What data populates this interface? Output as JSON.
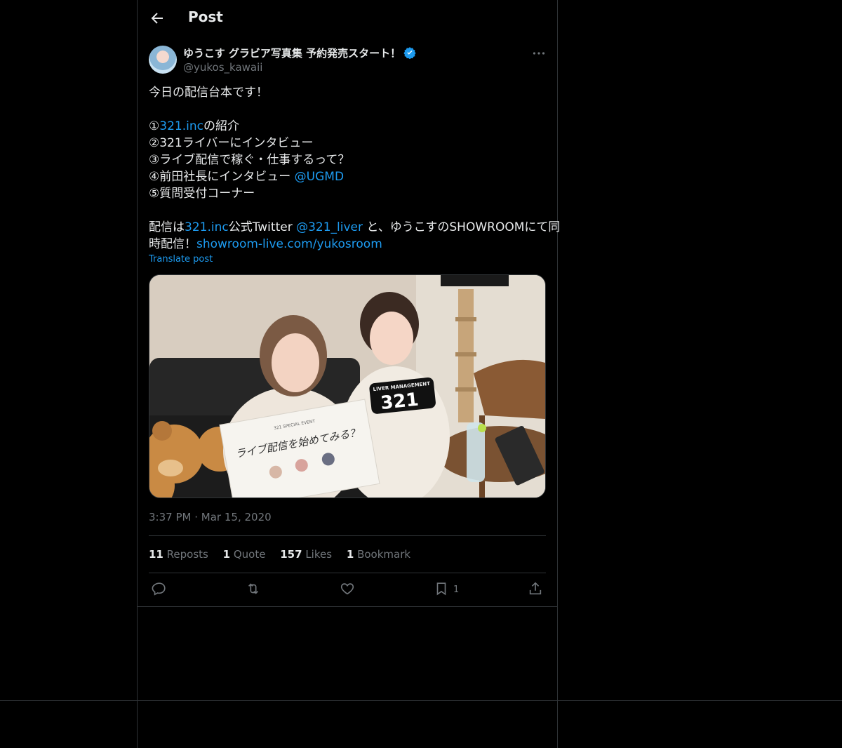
{
  "header": {
    "title": "Post"
  },
  "author": {
    "display_name": "ゆうこす グラビア写真集 予約発売スタート！",
    "handle": "@yukos_kawaii"
  },
  "tweet": {
    "line1": "今日の配信台本です！",
    "item1_num": "①",
    "item1_link": "321.inc",
    "item1_text": "の紹介",
    "item2": "②321ライバーにインタビュー",
    "item3": "③ライブ配信で稼ぐ・仕事するって？",
    "item4_text": "④前田社長にインタビュー ",
    "item4_mention": "@UGMD",
    "item5": "⑤質問受付コーナー",
    "p2_a": "配信は",
    "p2_link": "321.inc",
    "p2_b": "公式Twitter ",
    "p2_mention": "@321_liver",
    "p2_c": " と、ゆうこすのSHOWROOMにて同",
    "p2_d": "時配信！",
    "p2_url": "showroom-live.com/yukosroom",
    "translate_label": "Translate post"
  },
  "media": {
    "board_top": "321 SPECIAL EVENT",
    "board_title": "ライブ配信を始めてみる？",
    "sign_small": "LIVER MANAGEMENT",
    "sign_big": "321"
  },
  "meta": {
    "time": "3:37 PM",
    "dot": "·",
    "date": "Mar 15, 2020"
  },
  "stats": {
    "reposts_count": "11",
    "reposts_label": "Reposts",
    "quotes_count": "1",
    "quotes_label": "Quote",
    "likes_count": "157",
    "likes_label": "Likes",
    "bookmarks_count": "1",
    "bookmarks_label": "Bookmark"
  },
  "actions": {
    "bookmark_count": "1"
  },
  "colors": {
    "accent": "#1d9bf0",
    "text": "#e7e9ea",
    "muted": "#71767b",
    "border": "#2f3336",
    "bg": "#000000"
  },
  "icons": [
    "back-arrow-icon",
    "verified-badge-icon",
    "more-icon",
    "reply-icon",
    "repost-icon",
    "like-icon",
    "bookmark-icon",
    "share-icon"
  ]
}
